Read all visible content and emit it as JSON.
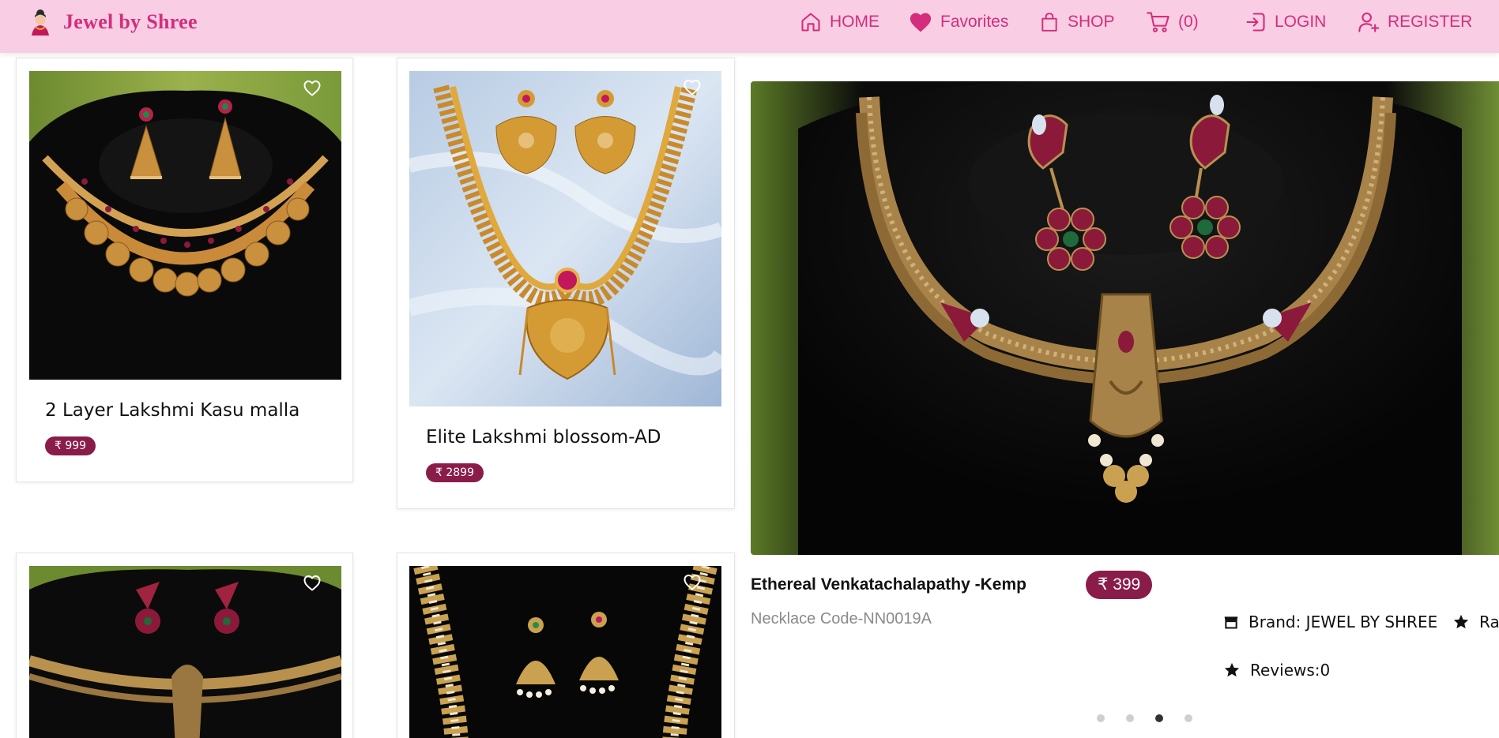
{
  "brand": {
    "name": "Jewel by Shree",
    "logo_icon": "jewelry-lady-logo"
  },
  "nav": {
    "home": "HOME",
    "favorites": "Favorites",
    "shop": "SHOP",
    "cart_count": "(0)",
    "login": "LOGIN",
    "register": "REGISTER"
  },
  "products": [
    {
      "title": "2 Layer Lakshmi Kasu malla",
      "price": "₹ 999"
    },
    {
      "title": "Elite Lakshmi blossom-AD",
      "price": "₹ 2899"
    }
  ],
  "featured": {
    "title": "Ethereal Venkatachalapathy -Kemp",
    "price": "₹ 399",
    "code": "Necklace Code-NN0019A",
    "brand": "Brand: JEWEL BY SHREE",
    "rating": "Rat",
    "reviews": "Reviews:0",
    "active_slide": 3,
    "slide_count": 4
  },
  "colors": {
    "nav_bg": "#f9cee4",
    "brand_pink": "#d42d7c",
    "price_badge": "#8a1c4a"
  }
}
